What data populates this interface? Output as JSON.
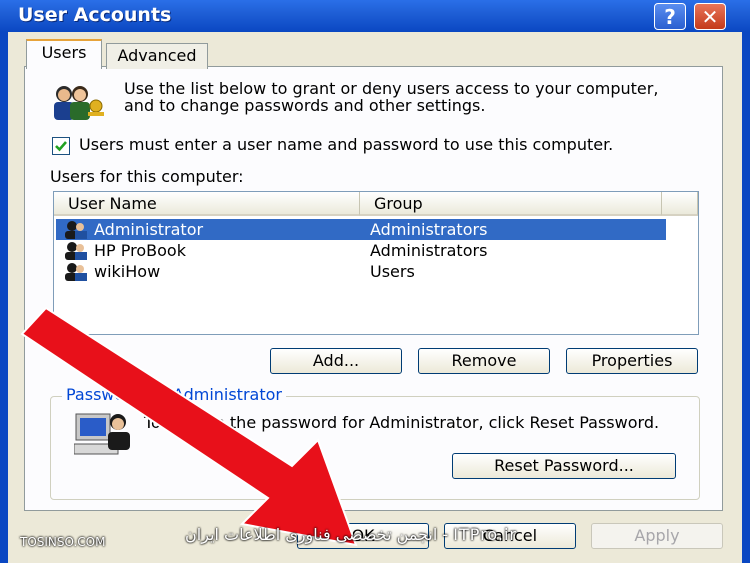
{
  "window": {
    "title": "User Accounts",
    "help_glyph": "?",
    "close_glyph": "✕"
  },
  "tabs": [
    {
      "label": "Users",
      "selected": true
    },
    {
      "label": "Advanced",
      "selected": false
    }
  ],
  "intro_text": "Use the list below to grant or deny users access to your computer, and to change passwords and other settings.",
  "require_login": {
    "label": "Users must enter a user name and password to use this computer.",
    "checked": true
  },
  "list_label": "Users for this computer:",
  "columns": [
    "User Name",
    "Group"
  ],
  "users": [
    {
      "name": "Administrator",
      "group": "Administrators",
      "selected": true
    },
    {
      "name": "HP ProBook",
      "group": "Administrators",
      "selected": false
    },
    {
      "name": "wikiHow",
      "group": "Users",
      "selected": false
    }
  ],
  "list_buttons": {
    "add": "Add...",
    "remove": "Remove",
    "properties": "Properties"
  },
  "password_group": {
    "legend": "Password for Administrator",
    "text": "To change the password for Administrator, click Reset Password.",
    "reset_button": "Reset Password..."
  },
  "dialog_buttons": {
    "ok": "OK",
    "cancel": "Cancel",
    "apply": "Apply"
  },
  "watermarks": {
    "left": "TOSINSO.COM",
    "center": "انجمن تخصصی فناوری اطلاعات ایران - ITPro.ir"
  },
  "colors": {
    "title_bar": "#0a47c2",
    "selection": "#316ac5",
    "arrow": "#e8101a"
  },
  "icons": [
    "help-icon",
    "close-icon",
    "users-keys-icon",
    "user-icon",
    "computer-user-icon",
    "checkmark-icon"
  ]
}
